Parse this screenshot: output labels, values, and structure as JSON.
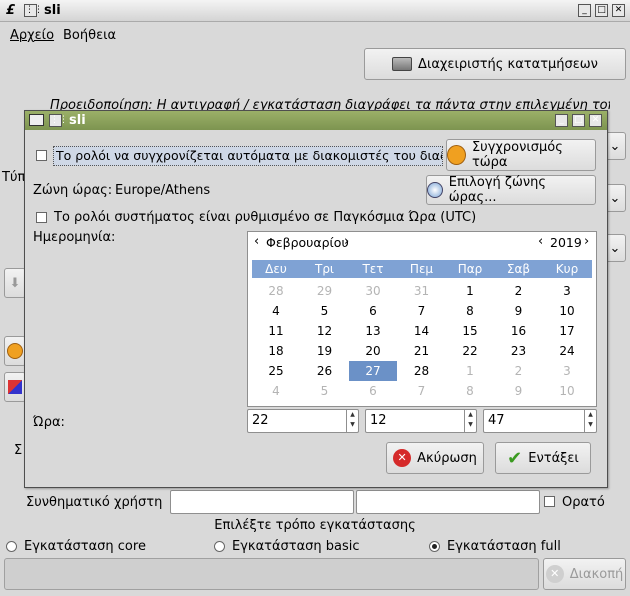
{
  "main": {
    "title": "sli",
    "menu": [
      "Αρχείο",
      "Βοήθεια"
    ],
    "partition_manager_label": "Διαχειριστής κατατμήσεων",
    "warning_text": "Προειδοποίηση: Η αντιγραφή / εγκατάσταση διαγράφει τα πάντα στην επιλεγμένη τοποθεσία",
    "side_label_typ": "Τύπ",
    "side_label_s": "Σ",
    "password_label": "Συνθηματικό χρήστη",
    "visible_label": "Ορατό",
    "install_mode_label": "Επιλέξτε τρόπο εγκατάστασης",
    "install_options": [
      "Εγκατάσταση core",
      "Εγκατάσταση basic",
      "Εγκατάσταση full"
    ],
    "selected_install_option": 2,
    "stop_label": "Διακοπή"
  },
  "dialog": {
    "title": "sli",
    "ntp_label": "Το ρολόι να συγχρονίζεται αυτόματα με διακομιστές του διαδικτύου",
    "sync_now_label": "Συγχρονισμός τώρα",
    "timezone_label": "Ζώνη ώρας:",
    "timezone_value": "Europe/Athens",
    "choose_zone_label": "Επιλογή ζώνης ώρας...",
    "utc_label": "Το ρολόι συστήματος είναι ρυθμισμένο σε Παγκόσμια Ώρα (UTC)",
    "date_label": "Ημερομηνία:",
    "month": "Φεβρουαρίου",
    "year": "2019",
    "weekdays": [
      "Δευ",
      "Τρι",
      "Τετ",
      "Πεμ",
      "Παρ",
      "Σαβ",
      "Κυρ"
    ],
    "days": [
      [
        "28",
        "29",
        "30",
        "31",
        "1",
        "2",
        "3"
      ],
      [
        "4",
        "5",
        "6",
        "7",
        "8",
        "9",
        "10"
      ],
      [
        "11",
        "12",
        "13",
        "14",
        "15",
        "16",
        "17"
      ],
      [
        "18",
        "19",
        "20",
        "21",
        "22",
        "23",
        "24"
      ],
      [
        "25",
        "26",
        "27",
        "28",
        "1",
        "2",
        "3"
      ],
      [
        "4",
        "5",
        "6",
        "7",
        "8",
        "9",
        "10"
      ]
    ],
    "selected_day": "27",
    "time_label": "Ώρα:",
    "hour": "22",
    "minute": "12",
    "second": "47",
    "cancel_label": "Ακύρωση",
    "ok_label": "Εντάξει"
  },
  "colors": {
    "dialog_title": "#8aa05a",
    "selection": "#6b91c7",
    "calendar_header": "#7fa2d4"
  }
}
